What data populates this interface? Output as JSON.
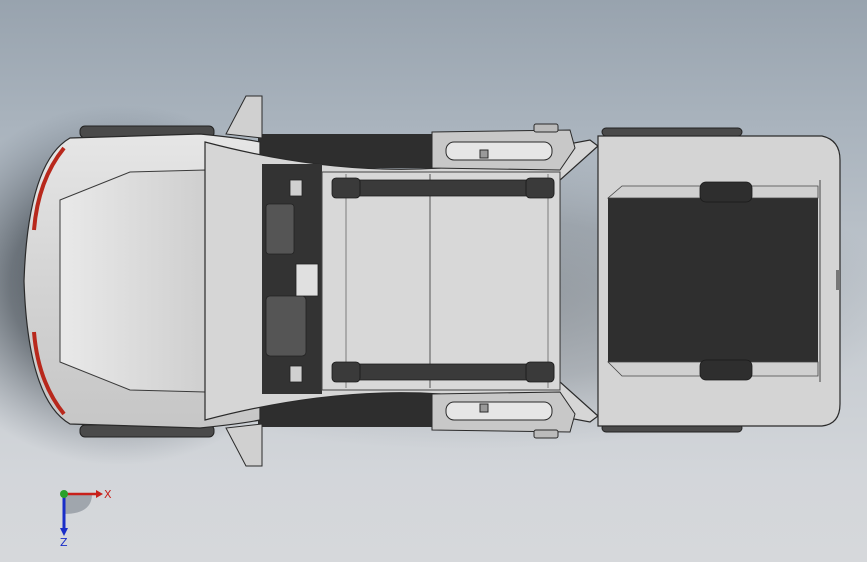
{
  "viewport": {
    "background_top": "#98a3ae",
    "background_bottom": "#d6d8db",
    "shadow_color": "#1c2228"
  },
  "model": {
    "body_color": "#d8d8d8",
    "body_stroke": "#2a2a2a",
    "dark_color": "#333333",
    "tail_light_color": "#b8281c",
    "tire_color": "#4a4a4a"
  },
  "triad": {
    "x_label": "X",
    "z_label": "Z",
    "x_color": "#c8201a",
    "y_color": "#2aa02a",
    "z_color": "#1a2ec8"
  }
}
